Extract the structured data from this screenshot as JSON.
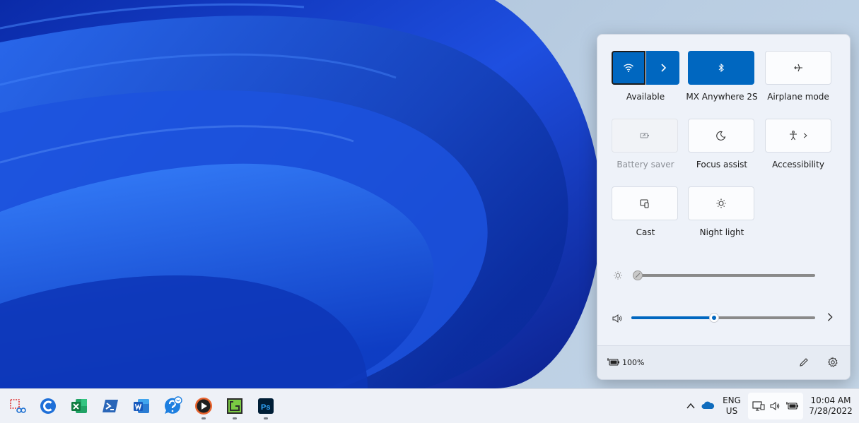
{
  "quick_settings": {
    "tiles": [
      {
        "label": "Available",
        "state": "on"
      },
      {
        "label": "MX Anywhere 2S",
        "state": "on"
      },
      {
        "label": "Airplane mode",
        "state": "off"
      },
      {
        "label": "Battery saver",
        "state": "disabled"
      },
      {
        "label": "Focus assist",
        "state": "off"
      },
      {
        "label": "Accessibility",
        "state": "off"
      },
      {
        "label": "Cast",
        "state": "off"
      },
      {
        "label": "Night light",
        "state": "off"
      }
    ],
    "brightness": {
      "icon": "brightness-icon",
      "level": 0
    },
    "volume": {
      "icon": "speaker-icon",
      "level": 0.45
    },
    "battery_percent": "100%"
  },
  "taskbar": {
    "apps": [
      {
        "icon": "snipping-tool-icon",
        "running": false
      },
      {
        "icon": "ccleaner-icon",
        "running": false
      },
      {
        "icon": "excel-icon",
        "running": false
      },
      {
        "icon": "powershell-icon",
        "running": false
      },
      {
        "icon": "word-icon",
        "running": false
      },
      {
        "icon": "get-help-icon",
        "running": false
      },
      {
        "icon": "media-player-icon",
        "running": true
      },
      {
        "icon": "greenshot-icon",
        "running": true
      },
      {
        "icon": "photoshop-icon",
        "running": true
      }
    ],
    "language": {
      "line1": "ENG",
      "line2": "US"
    },
    "time": "10:04 AM",
    "date": "7/28/2022"
  },
  "colors": {
    "accent": "#0067c0",
    "panel_bg": "#eef2f9",
    "taskbar_bg": "#eef1f7"
  }
}
